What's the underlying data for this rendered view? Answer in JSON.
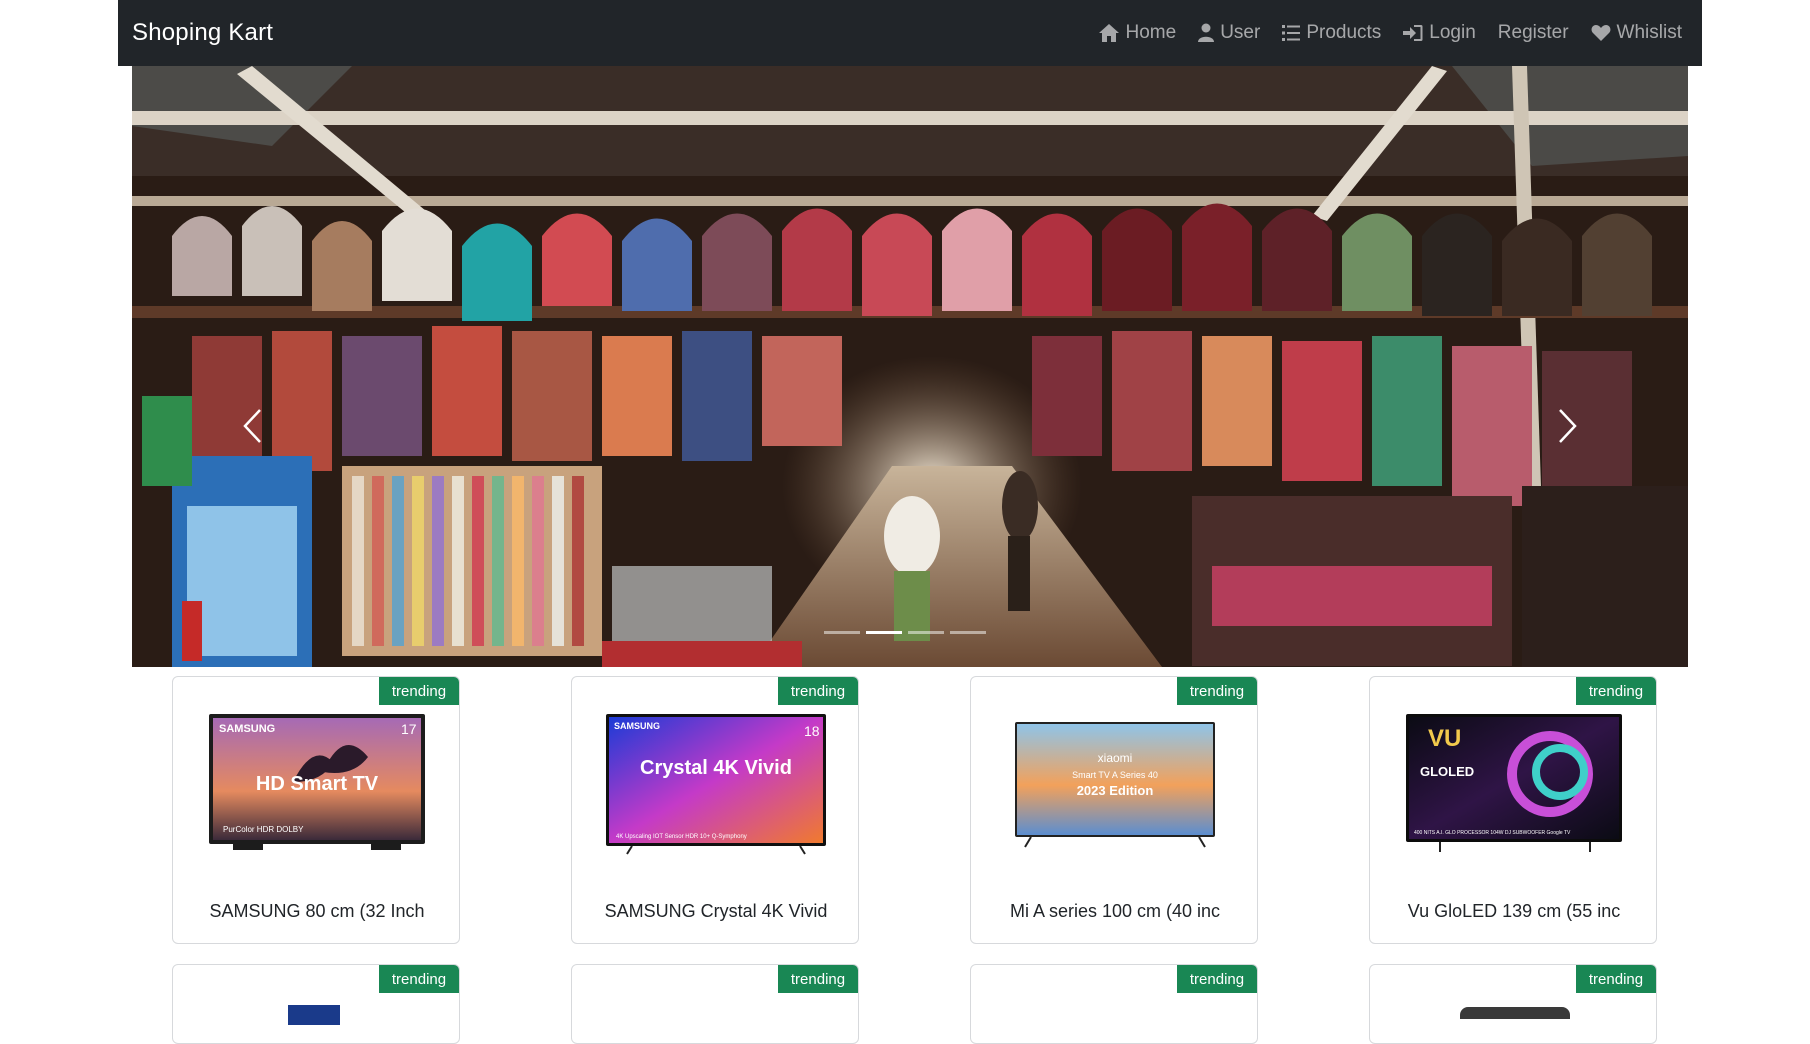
{
  "brand": "Shoping Kart",
  "nav": [
    {
      "icon": "home-icon",
      "label": "Home"
    },
    {
      "icon": "user-icon",
      "label": "User"
    },
    {
      "icon": "list-icon",
      "label": "Products"
    },
    {
      "icon": "login-icon",
      "label": "Login"
    },
    {
      "icon": "",
      "label": "Register"
    },
    {
      "icon": "heart-icon",
      "label": "Whislist"
    }
  ],
  "carousel": {
    "slide_count": 4,
    "active_index": 1
  },
  "products": [
    {
      "badge": "trending",
      "title": "SAMSUNG 80 cm (32 Inch",
      "image": {
        "brand": "SAMSUNG",
        "headline": "HD Smart TV",
        "number": "17",
        "footer": "PurColor   HDR   DOLBY"
      }
    },
    {
      "badge": "trending",
      "title": "SAMSUNG Crystal 4K Vivid",
      "image": {
        "brand": "SAMSUNG",
        "headline": "Crystal 4K Vivid",
        "number": "18",
        "footer": "4K Upscaling   IOT Sensor   HDR 10+   Q-Symphony"
      }
    },
    {
      "badge": "trending",
      "title": "Mi A series 100 cm (40 inc",
      "image": {
        "brand": "xiaomi",
        "headline": "2023 Edition",
        "sub": "Smart TV A Series 40"
      }
    },
    {
      "badge": "trending",
      "title": "Vu GloLED 139 cm (55 inc",
      "image": {
        "brand": "VU",
        "headline": "GLOLED",
        "footer": "400 NITS   A.I. GLO PROCESSOR   104W DJ SUBWOOFER   Google TV"
      }
    },
    {
      "badge": "trending",
      "title": ""
    },
    {
      "badge": "trending",
      "title": ""
    },
    {
      "badge": "trending",
      "title": ""
    },
    {
      "badge": "trending",
      "title": ""
    }
  ]
}
